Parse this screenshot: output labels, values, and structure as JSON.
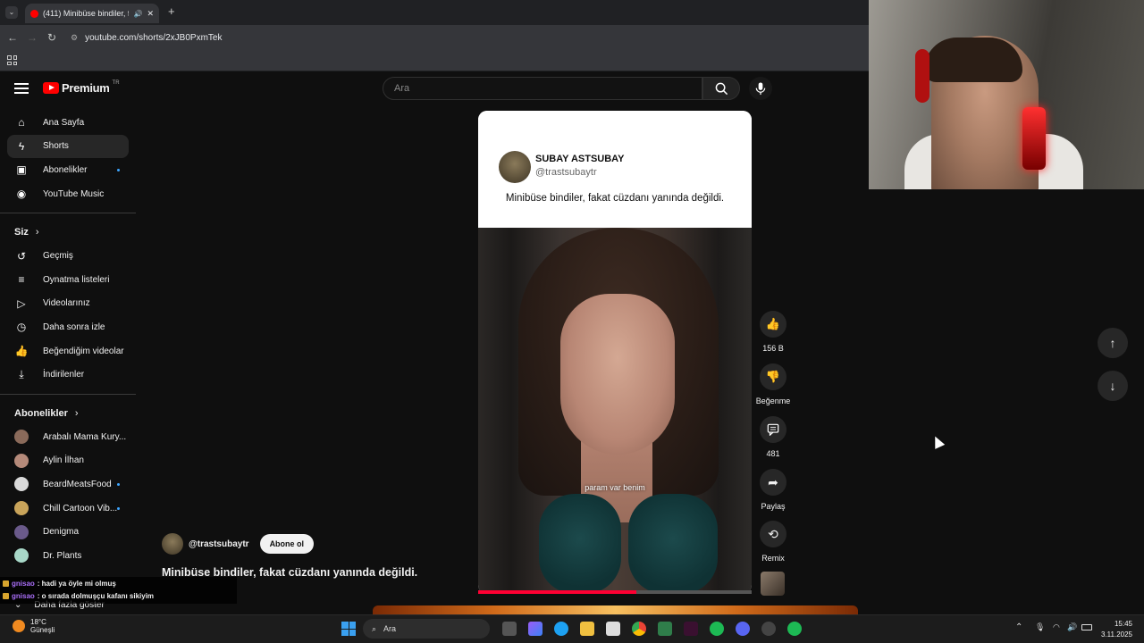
{
  "browser": {
    "tab_title": "(411) Minibüse bindiler, fak",
    "url": "youtube.com/shorts/2xJB0PxmTek"
  },
  "header": {
    "logo_text": "Premium",
    "logo_region": "TR",
    "search_placeholder": "Ara"
  },
  "sidebar": {
    "main_items": [
      {
        "label": "Ana Sayfa",
        "icon": "home-icon"
      },
      {
        "label": "Shorts",
        "icon": "shorts-icon",
        "active": true
      },
      {
        "label": "Abonelikler",
        "icon": "subscriptions-icon",
        "dot": true
      },
      {
        "label": "YouTube Music",
        "icon": "music-icon"
      }
    ],
    "you_heading": "Siz",
    "you_items": [
      {
        "label": "Geçmiş",
        "icon": "history-icon"
      },
      {
        "label": "Oynatma listeleri",
        "icon": "playlists-icon"
      },
      {
        "label": "Videolarınız",
        "icon": "your-videos-icon"
      },
      {
        "label": "Daha sonra izle",
        "icon": "watch-later-icon"
      },
      {
        "label": "Beğendiğim videolar",
        "icon": "liked-icon"
      },
      {
        "label": "İndirilenler",
        "icon": "downloads-icon"
      }
    ],
    "subs_heading": "Abonelikler",
    "subs_items": [
      {
        "label": "Arabalı Mama Kury...",
        "color": "#8a6a5a",
        "dot": false
      },
      {
        "label": "Aylin İlhan",
        "color": "#b58a7a",
        "dot": false
      },
      {
        "label": "BeardMeatsFood",
        "color": "#d9d9d9",
        "dot": true
      },
      {
        "label": "Chill Cartoon Vib...",
        "color": "#c9a45a",
        "dot": true
      },
      {
        "label": "Denigma",
        "color": "#6a5a8a",
        "dot": false
      },
      {
        "label": "Dr. Plants",
        "color": "#a8d8c8",
        "dot": false
      }
    ],
    "show_more": "Daha fazla göster"
  },
  "short": {
    "author_name": "SUBAY ASTSUBAY",
    "author_handle": "@trastsubaytr",
    "caption": "Minibüse bindiler, fakat cüzdanı yanında değildi.",
    "subtitle": "param var benim",
    "progress": 0.58,
    "channel_handle": "@trastsubaytr",
    "subscribe_label": "Abone ol",
    "title": "Minibüse bindiler, fakat cüzdanı yanında değildi."
  },
  "actions": {
    "like_count": "156 B",
    "dislike_label": "Beğenme",
    "comment_count": "481",
    "share_label": "Paylaş",
    "remix_label": "Remix"
  },
  "chat": [
    {
      "user": "gnisao",
      "message": ": hadi ya öyle mi olmuş"
    },
    {
      "user": "gnisao",
      "message": ": o sırada dolmuşçu kafanı sikiyim"
    }
  ],
  "taskbar": {
    "temperature": "18°C",
    "weather": "Güneşli",
    "search_label": "Ara",
    "time": "15:45",
    "date": "3.11.2025"
  }
}
